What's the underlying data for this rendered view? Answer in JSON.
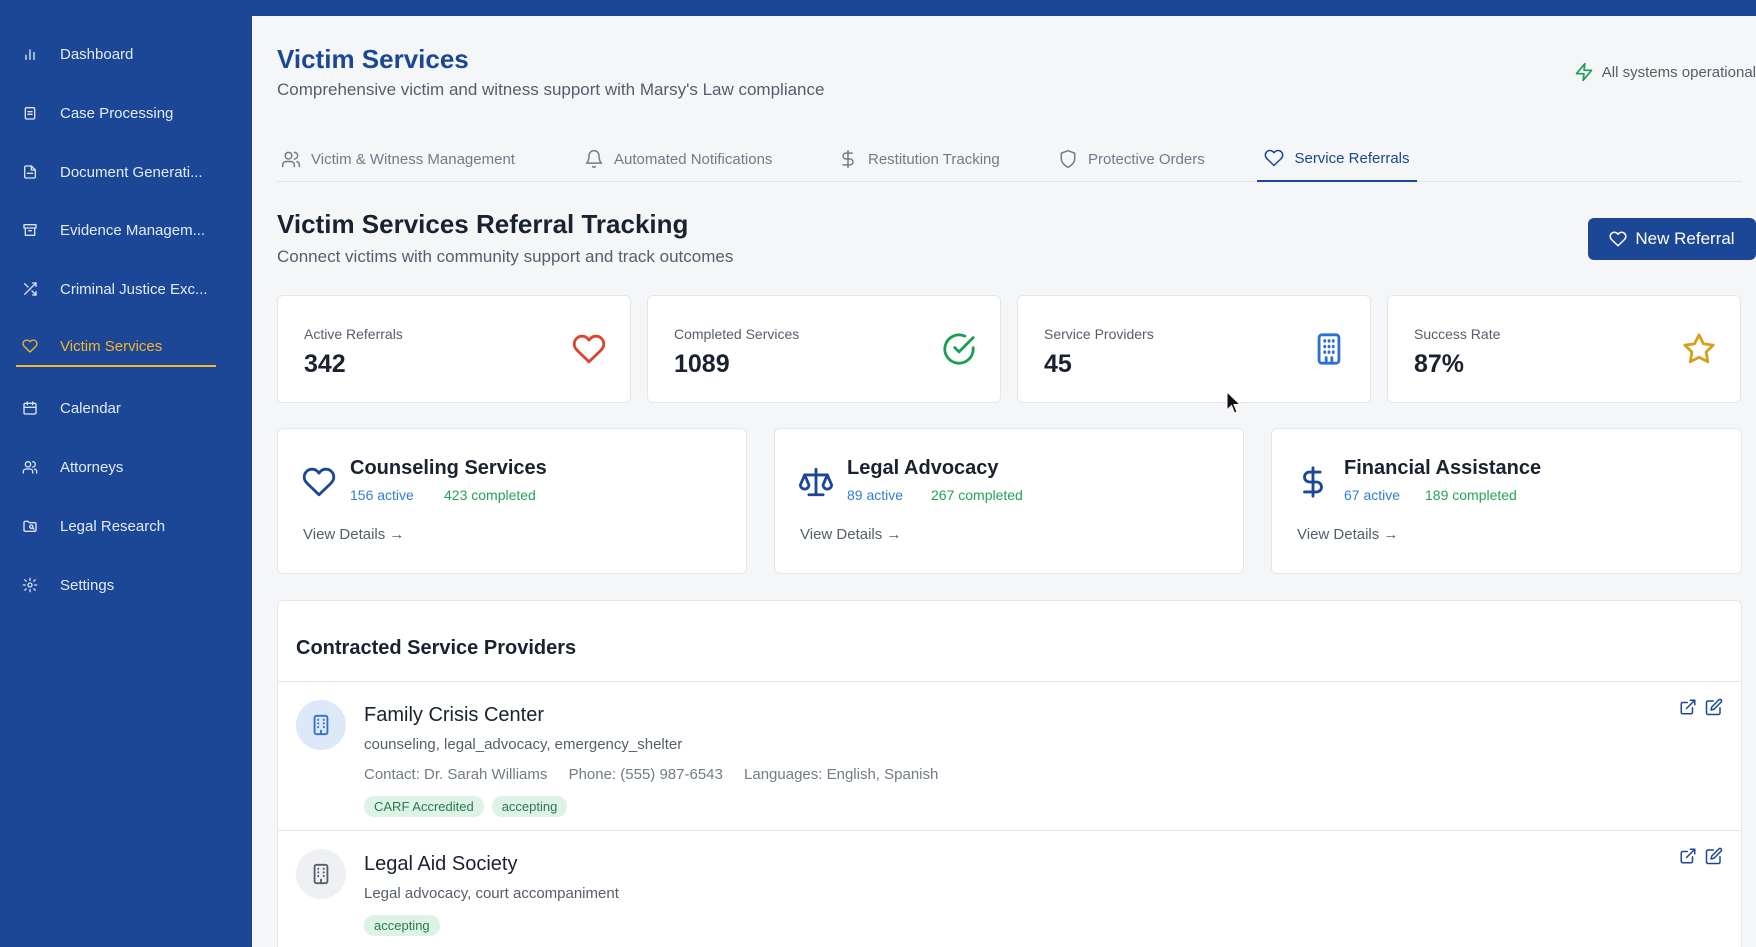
{
  "sidebar": {
    "items": [
      {
        "label": "Dashboard",
        "icon": "bar-chart-icon"
      },
      {
        "label": "Case Processing",
        "icon": "clipboard-icon"
      },
      {
        "label": "Document Generati...",
        "icon": "document-icon"
      },
      {
        "label": "Evidence Managem...",
        "icon": "archive-icon"
      },
      {
        "label": "Criminal Justice Exc...",
        "icon": "shuffle-icon"
      },
      {
        "label": "Victim Services",
        "icon": "heart-icon",
        "active": true
      },
      {
        "label": "Calendar",
        "icon": "calendar-icon"
      },
      {
        "label": "Attorneys",
        "icon": "users-icon"
      },
      {
        "label": "Legal Research",
        "icon": "folder-search-icon"
      },
      {
        "label": "Settings",
        "icon": "gear-icon"
      }
    ]
  },
  "header": {
    "title": "Victim Services",
    "subtitle": "Comprehensive victim and witness support with Marsy's Law compliance",
    "status": "All systems operational"
  },
  "tabs": [
    {
      "label": "Victim & Witness Management",
      "icon": "users-icon"
    },
    {
      "label": "Automated Notifications",
      "icon": "bell-icon"
    },
    {
      "label": "Restitution Tracking",
      "icon": "dollar-icon"
    },
    {
      "label": "Protective Orders",
      "icon": "shield-icon"
    },
    {
      "label": "Service Referrals",
      "icon": "heart-icon",
      "active": true
    }
  ],
  "section": {
    "title": "Victim Services Referral Tracking",
    "subtitle": "Connect victims with community support and track outcomes",
    "new_button": "New Referral"
  },
  "stats": [
    {
      "label": "Active Referrals",
      "value": "342",
      "icon": "heart-icon",
      "color": "#d9462f"
    },
    {
      "label": "Completed Services",
      "value": "1089",
      "icon": "check-circle-icon",
      "color": "#1f9d55"
    },
    {
      "label": "Service Providers",
      "value": "45",
      "icon": "building-icon",
      "color": "#2f6fd0"
    },
    {
      "label": "Success Rate",
      "value": "87%",
      "icon": "star-icon",
      "color": "#d4a020"
    }
  ],
  "services": [
    {
      "title": "Counseling Services",
      "active": "156 active",
      "completed": "423 completed",
      "link": "View Details →",
      "icon": "heart-icon"
    },
    {
      "title": "Legal Advocacy",
      "active": "89 active",
      "completed": "267 completed",
      "link": "View Details →",
      "icon": "scale-icon"
    },
    {
      "title": "Financial Assistance",
      "active": "67 active",
      "completed": "189 completed",
      "link": "View Details →",
      "icon": "dollar-icon"
    }
  ],
  "providers": {
    "title": "Contracted Service Providers",
    "rows": [
      {
        "name": "Family Crisis Center",
        "services": "counseling, legal_advocacy, emergency_shelter",
        "contact": "Contact: Dr. Sarah Williams",
        "phone": "Phone: (555) 987-6543",
        "languages": "Languages: English, Spanish",
        "tags": [
          "CARF Accredited",
          "accepting"
        ]
      },
      {
        "name": "Legal Aid Society",
        "services": "Legal advocacy, court accompaniment",
        "tags": [
          "accepting"
        ]
      }
    ]
  },
  "colors": {
    "brand": "#1b4796",
    "accent": "#f5b52e",
    "success": "#1f9d55",
    "info": "#2f7fd4"
  }
}
